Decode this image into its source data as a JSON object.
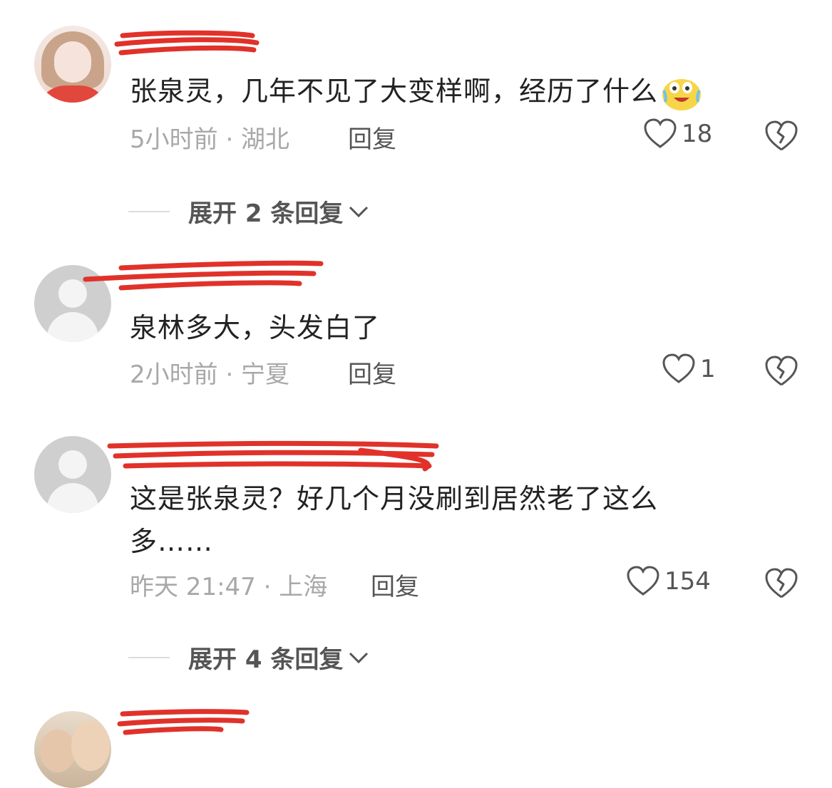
{
  "comments": [
    {
      "content": "张泉灵，几年不见了大变样啊，经历了什么",
      "time_location": "5小时前 · 湖北",
      "reply_label": "回复",
      "likes": "18",
      "avatar_icon": "girl-portrait-avatar"
    },
    {
      "content": "泉林多大，头发白了",
      "time_location": "2小时前 · 宁夏",
      "reply_label": "回复",
      "likes": "1",
      "avatar_icon": "default-avatar"
    },
    {
      "content_line1": "这是张泉灵？好几个月没刷到居然老了这么",
      "content_line2": "多……",
      "time_location": "昨天 21:47 · 上海",
      "reply_label": "回复",
      "likes": "154",
      "avatar_icon": "default-avatar"
    },
    {
      "avatar_icon": "kids-photo-avatar"
    }
  ],
  "expand_replies": [
    {
      "label": "展开 2 条回复"
    },
    {
      "label": "展开 4 条回复"
    }
  ],
  "colors": {
    "redaction": "#e0322a",
    "text": "#222222",
    "meta": "#a8a8a8"
  }
}
